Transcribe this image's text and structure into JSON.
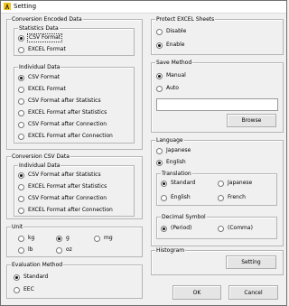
{
  "window": {
    "title": "Setting"
  },
  "conversion_encoded": {
    "label": "Conversion Encoded Data",
    "statistics": {
      "label": "Statistics Data",
      "options": [
        "CSV Format",
        "EXCEL Format"
      ],
      "selected": 0
    },
    "individual": {
      "label": "Individual Data",
      "options": [
        "CSV Format",
        "EXCEL Format",
        "CSV Format after Statistics",
        "EXCEL Format after Statistics",
        "CSV Format after Connection",
        "EXCEL Format after Connection"
      ],
      "selected": 0
    }
  },
  "conversion_csv": {
    "label": "Conversion CSV Data",
    "individual": {
      "label": "Individual Data",
      "options": [
        "CSV Format after Statistics",
        "EXCEL Format after Statistics",
        "CSV Format after Connection",
        "EXCEL Format after Connection"
      ],
      "selected": 0
    }
  },
  "unit": {
    "label": "Unit",
    "options": [
      "kg",
      "g",
      "mg",
      "lb",
      "oz"
    ],
    "selected": 1
  },
  "evaluation": {
    "label": "Evaluation Method",
    "options": [
      "Standard",
      "EEC"
    ],
    "selected": 0
  },
  "protect": {
    "label": "Protect EXCEL Sheets",
    "options": [
      "Disable",
      "Enable"
    ],
    "selected": 1
  },
  "save": {
    "label": "Save Method",
    "options": [
      "Manual",
      "Auto"
    ],
    "selected": 0,
    "path_value": "",
    "browse_label": "Browse"
  },
  "language": {
    "label": "Language",
    "options": [
      "Japanese",
      "English"
    ],
    "selected": 1,
    "translation": {
      "label": "Translation",
      "options": [
        "Standard",
        "Japanese",
        "English",
        "French"
      ],
      "selected": 0
    },
    "decimal": {
      "label": "Decimal Symbol",
      "options": [
        "(Period)",
        "(Comma)"
      ],
      "selected": 0
    }
  },
  "histogram": {
    "label": "Histogram",
    "button_label": "Setting"
  },
  "footer": {
    "ok_label": "OK",
    "cancel_label": "Cancel"
  }
}
